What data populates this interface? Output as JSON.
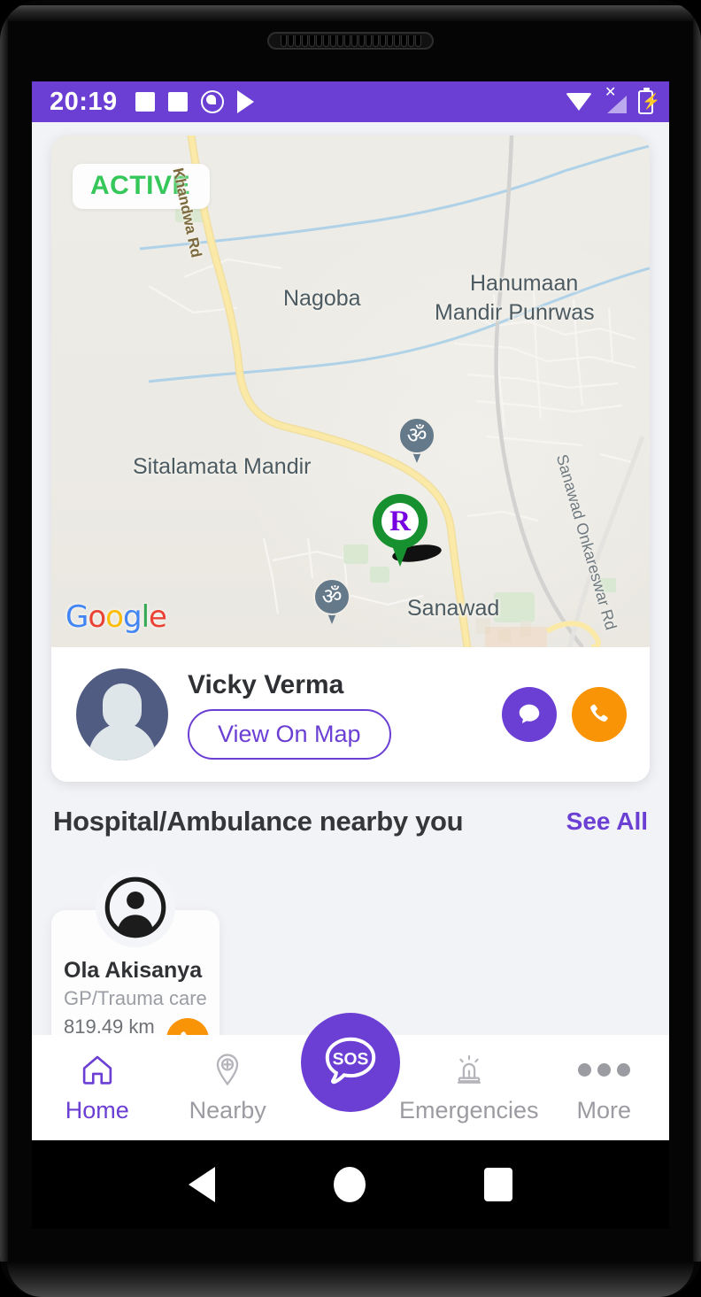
{
  "status_bar": {
    "time": "20:19",
    "icons_left": [
      "square-icon",
      "square-icon",
      "compass-circle-icon",
      "play-store-icon"
    ],
    "icons_right": [
      "wifi-icon",
      "no-signal-icon",
      "battery-charging-icon"
    ],
    "background_color": "#6B3FD4"
  },
  "map": {
    "status_badge": "ACTIVE",
    "status_badge_color": "#35C759",
    "attribution": "Google",
    "marker_letter": "R",
    "marker_pin_color": "#17912f",
    "marker_letter_color": "#7500E0",
    "labels": [
      {
        "name": "Nagoba",
        "type": "place"
      },
      {
        "name": "Hanumaan",
        "type": "place"
      },
      {
        "name": "Mandir Punrwas",
        "type": "place"
      },
      {
        "name": "Sitalamata Mandir",
        "type": "place"
      },
      {
        "name": "Sanawad",
        "type": "place"
      }
    ],
    "roads": [
      {
        "name": "Khandwa Rd",
        "type": "highway"
      },
      {
        "name": "Sanawad Onkareswar Rd",
        "type": "road"
      }
    ],
    "poi_icon": "om-temple-icon"
  },
  "user_card": {
    "name": "Vicky Verma",
    "view_on_map_label": "View On Map",
    "chat_icon": "chat-bubble-icon",
    "call_icon": "phone-icon",
    "chat_color": "#6B3FD4",
    "call_color": "#F89406",
    "avatar_icon": "person-avatar-icon"
  },
  "nearby_section": {
    "title": "Hospital/Ambulance nearby you",
    "see_all_label": "See All",
    "see_all_color": "#6B3FD4",
    "cards": [
      {
        "name": "Ola Akisanya",
        "role": "GP/Trauma care",
        "distance": "819.49 km",
        "call_icon": "phone-icon"
      }
    ]
  },
  "sos": {
    "label": "SOS",
    "color": "#6B3FD4",
    "icon": "sos-speech-bubble-icon"
  },
  "bottom_nav": {
    "items": [
      {
        "label": "Home",
        "icon": "home-icon",
        "active": true
      },
      {
        "label": "Nearby",
        "icon": "location-pin-plus-icon",
        "active": false
      },
      {
        "label": "Emergencies",
        "icon": "siren-icon",
        "active": false
      },
      {
        "label": "More",
        "icon": "ellipsis-icon",
        "active": false
      }
    ],
    "active_color": "#6B3FD4",
    "inactive_color": "#9b9ba2"
  },
  "system_nav": {
    "back": "back-triangle-icon",
    "home": "home-circle-icon",
    "recents": "recents-square-icon"
  }
}
